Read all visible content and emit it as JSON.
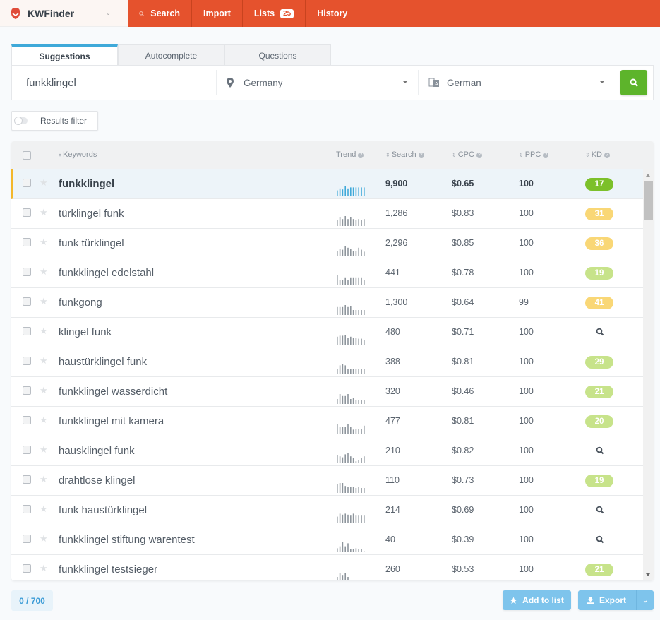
{
  "app": {
    "name": "KWFinder",
    "brand_color": "#e5522d"
  },
  "nav": {
    "search": "Search",
    "import": "Import",
    "lists": "Lists",
    "lists_count": "25",
    "history": "History"
  },
  "tabs": [
    {
      "label": "Suggestions",
      "active": true
    },
    {
      "label": "Autocomplete",
      "active": false
    },
    {
      "label": "Questions",
      "active": false
    }
  ],
  "search": {
    "keyword": "funkklingel",
    "location": "Germany",
    "language": "German"
  },
  "filter": {
    "label": "Results filter",
    "enabled": false
  },
  "table": {
    "headers": {
      "keywords": "Keywords",
      "trend": "Trend",
      "search": "Search",
      "cpc": "CPC",
      "ppc": "PPC",
      "kd": "KD"
    },
    "rows": [
      {
        "keyword": "funkklingel",
        "search": "9,900",
        "cpc": "$0.65",
        "ppc": "100",
        "kd": "17",
        "kd_color": "#7cc02a",
        "selected": true,
        "trend": [
          0.6,
          0.8,
          0.7,
          1.0,
          0.8,
          0.9,
          0.9,
          0.9,
          0.9,
          0.9,
          0.9
        ]
      },
      {
        "keyword": "türklingel funk",
        "search": "1,286",
        "cpc": "$0.83",
        "ppc": "100",
        "kd": "31",
        "kd_color": "#f9d776",
        "selected": false,
        "trend": [
          0.6,
          0.9,
          0.7,
          1.0,
          0.7,
          0.9,
          0.7,
          0.6,
          0.7,
          0.6,
          0.7
        ]
      },
      {
        "keyword": "funk türklingel",
        "search": "2,296",
        "cpc": "$0.85",
        "ppc": "100",
        "kd": "36",
        "kd_color": "#f9d776",
        "selected": false,
        "trend": [
          0.5,
          0.7,
          0.6,
          1.0,
          0.8,
          0.7,
          0.5,
          0.5,
          0.8,
          0.6,
          0.4
        ]
      },
      {
        "keyword": "funkklingel edelstahl",
        "search": "441",
        "cpc": "$0.78",
        "ppc": "100",
        "kd": "19",
        "kd_color": "#c7e38a",
        "selected": false,
        "trend": [
          1.0,
          0.5,
          0.5,
          0.8,
          0.5,
          0.8,
          0.8,
          0.8,
          0.8,
          0.8,
          0.5
        ]
      },
      {
        "keyword": "funkgong",
        "search": "1,300",
        "cpc": "$0.64",
        "ppc": "99",
        "kd": "41",
        "kd_color": "#f9d776",
        "selected": false,
        "trend": [
          0.8,
          0.8,
          0.8,
          1.0,
          0.8,
          0.9,
          0.5,
          0.5,
          0.5,
          0.5,
          0.5
        ]
      },
      {
        "keyword": "klingel funk",
        "search": "480",
        "cpc": "$0.71",
        "ppc": "100",
        "kd": "",
        "kd_color": "",
        "selected": false,
        "trend": [
          0.8,
          0.9,
          0.9,
          1.0,
          0.7,
          0.8,
          0.7,
          0.7,
          0.6,
          0.6,
          0.5
        ]
      },
      {
        "keyword": "haustürklingel funk",
        "search": "388",
        "cpc": "$0.81",
        "ppc": "100",
        "kd": "29",
        "kd_color": "#c7e38a",
        "selected": false,
        "trend": [
          0.5,
          0.9,
          1.0,
          0.9,
          0.5,
          0.5,
          0.5,
          0.5,
          0.5,
          0.5,
          0.5
        ]
      },
      {
        "keyword": "funkklingel wasserdicht",
        "search": "320",
        "cpc": "$0.46",
        "ppc": "100",
        "kd": "21",
        "kd_color": "#c7e38a",
        "selected": false,
        "trend": [
          0.5,
          1.0,
          0.8,
          0.8,
          1.0,
          0.5,
          0.6,
          0.4,
          0.4,
          0.4,
          0.4
        ]
      },
      {
        "keyword": "funkklingel mit kamera",
        "search": "477",
        "cpc": "$0.81",
        "ppc": "100",
        "kd": "20",
        "kd_color": "#c7e38a",
        "selected": false,
        "trend": [
          1.0,
          0.7,
          0.7,
          0.7,
          1.0,
          0.7,
          0.4,
          0.5,
          0.5,
          0.5,
          0.8
        ]
      },
      {
        "keyword": "hausklingel funk",
        "search": "210",
        "cpc": "$0.82",
        "ppc": "100",
        "kd": "",
        "kd_color": "",
        "selected": false,
        "trend": [
          0.8,
          0.7,
          0.6,
          0.9,
          1.0,
          0.7,
          0.5,
          0.2,
          0.3,
          0.5,
          0.7
        ]
      },
      {
        "keyword": "drahtlose klingel",
        "search": "110",
        "cpc": "$0.73",
        "ppc": "100",
        "kd": "19",
        "kd_color": "#c7e38a",
        "selected": false,
        "trend": [
          0.9,
          1.0,
          1.0,
          0.7,
          0.6,
          0.6,
          0.6,
          0.5,
          0.6,
          0.5,
          0.5
        ]
      },
      {
        "keyword": "funk haustürklingel",
        "search": "214",
        "cpc": "$0.69",
        "ppc": "100",
        "kd": "",
        "kd_color": "",
        "selected": false,
        "trend": [
          0.6,
          0.9,
          0.8,
          0.9,
          0.8,
          0.7,
          0.9,
          0.7,
          0.7,
          0.7,
          0.7
        ]
      },
      {
        "keyword": "funkklingel stiftung warentest",
        "search": "40",
        "cpc": "$0.39",
        "ppc": "100",
        "kd": "",
        "kd_color": "",
        "selected": false,
        "trend": [
          0.4,
          0.6,
          1.0,
          0.6,
          0.9,
          0.3,
          0.3,
          0.4,
          0.3,
          0.3,
          0.1
        ]
      },
      {
        "keyword": "funkklingel testsieger",
        "search": "260",
        "cpc": "$0.53",
        "ppc": "100",
        "kd": "21",
        "kd_color": "#c7e38a",
        "selected": false,
        "trend": [
          0.5,
          0.9,
          0.7,
          0.9,
          0.5,
          0.2,
          0.2,
          0.1,
          0.1,
          0.1,
          0.1
        ]
      }
    ]
  },
  "footer": {
    "selection_count": "0 / 700",
    "add_to_list": "Add to list",
    "export": "Export"
  }
}
